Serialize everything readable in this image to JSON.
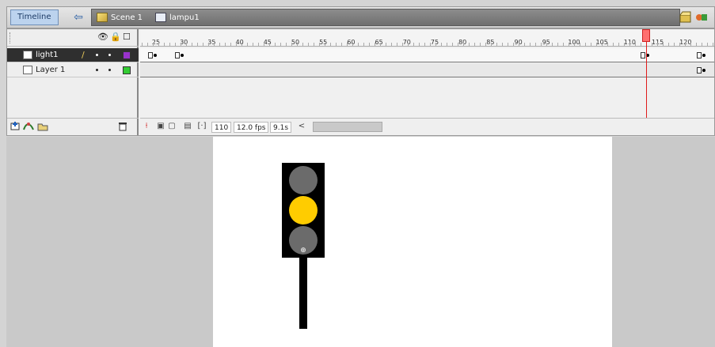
{
  "topbar": {
    "timeline_label": "Timeline",
    "back_icon": "back-arrow-icon",
    "scene_label": "Scene 1",
    "symbol_label": "lampu1",
    "edit_scene_icon": "edit-scene-icon",
    "edit_symbol_icon": "edit-symbol-icon"
  },
  "timeline": {
    "header_icons": [
      "eye-icon",
      "lock-icon",
      "outline-icon"
    ],
    "ruler_ticks": [
      "25",
      "30",
      "35",
      "40",
      "45",
      "50",
      "55",
      "60",
      "65",
      "70",
      "75",
      "80",
      "85",
      "90",
      "95",
      "100",
      "105",
      "110",
      "115",
      "120"
    ],
    "layers": [
      {
        "name": "light1",
        "selected": true,
        "color": "#9933cc"
      },
      {
        "name": "Layer 1",
        "selected": false,
        "color": "#33cc33"
      }
    ],
    "footer_icons": [
      "new-layer-icon",
      "add-motion-guide-icon",
      "new-folder-icon",
      "trash-icon"
    ],
    "status": {
      "current_frame": "110",
      "frame_rate": "12.0 fps",
      "elapsed_time": "9.1s",
      "scroll_left": "<"
    },
    "playhead_frame": 110
  },
  "stage": {
    "background": "#ffffff",
    "pasteboard": "#c9c9c9",
    "traffic_light": {
      "housing_color": "#000000",
      "lamps": [
        {
          "name": "top-lamp",
          "color": "#6b6b6b"
        },
        {
          "name": "middle-lamp",
          "color": "#ffcc00"
        },
        {
          "name": "bottom-lamp",
          "color": "#6b6b6b"
        }
      ]
    }
  },
  "colors": {
    "timeline_button": "#bcd3ee",
    "selected_layer": "#2f2f2f",
    "playhead": "#e01b1b"
  }
}
